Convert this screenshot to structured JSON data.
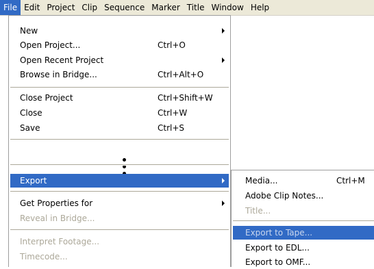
{
  "menubar": {
    "items": [
      "File",
      "Edit",
      "Project",
      "Clip",
      "Sequence",
      "Marker",
      "Title",
      "Window",
      "Help"
    ]
  },
  "file_menu": {
    "new": {
      "label": "New"
    },
    "open_project": {
      "label": "Open Project...",
      "shortcut": "Ctrl+O"
    },
    "open_recent_project": {
      "label": "Open Recent Project"
    },
    "browse_in_bridge": {
      "label": "Browse in Bridge...",
      "shortcut": "Ctrl+Alt+O"
    },
    "close_project": {
      "label": "Close Project",
      "shortcut": "Ctrl+Shift+W"
    },
    "close": {
      "label": "Close",
      "shortcut": "Ctrl+W"
    },
    "save": {
      "label": "Save",
      "shortcut": "Ctrl+S"
    },
    "export": {
      "label": "Export"
    },
    "get_properties_for": {
      "label": "Get Properties for"
    },
    "reveal_in_bridge": {
      "label": "Reveal in Bridge..."
    },
    "interpret_footage": {
      "label": "Interpret Footage..."
    },
    "timecode": {
      "label": "Timecode..."
    }
  },
  "export_submenu": {
    "media": {
      "label": "Media...",
      "shortcut": "Ctrl+M"
    },
    "adobe_clip_notes": {
      "label": "Adobe Clip Notes..."
    },
    "title": {
      "label": "Title..."
    },
    "export_to_tape": {
      "label": "Export to Tape..."
    },
    "export_to_edl": {
      "label": "Export to EDL..."
    },
    "export_to_omf": {
      "label": "Export to OMF..."
    }
  },
  "colors": {
    "highlight": "#316ac5",
    "menubar_bg": "#ece9d8",
    "disabled_text": "#aca899"
  }
}
